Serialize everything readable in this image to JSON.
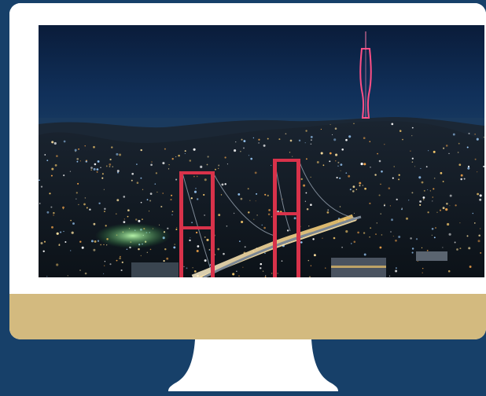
{
  "device": {
    "type": "desktop-monitor",
    "colors": {
      "background": "#174069",
      "bezel": "#ffffff",
      "chin": "#d3ba7f",
      "stand": "#ffffff"
    }
  },
  "screen_image": {
    "subject": "night-city-bridge-photo",
    "colors": {
      "sky": "#0a1f3d",
      "bridge_towers": "#e0334a",
      "tower_lights": "#ff5a8a",
      "city_lights": "#f2c66a"
    }
  }
}
